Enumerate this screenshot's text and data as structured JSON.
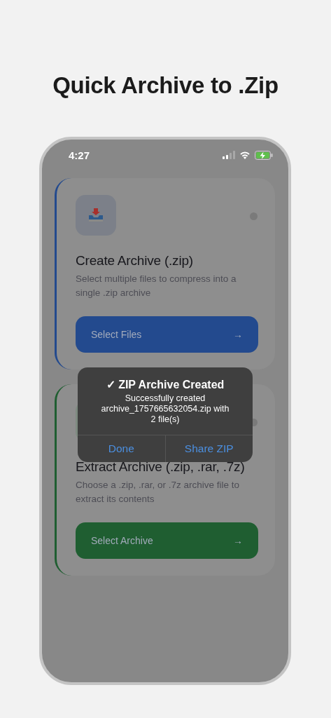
{
  "headline": "Quick Archive to .Zip",
  "status_bar": {
    "time": "4:27"
  },
  "cards": [
    {
      "title": "Create Archive (.zip)",
      "description": "Select multiple files to compress into a single .zip archive",
      "button": "Select Files",
      "arrow": "→",
      "color": "#234a8e"
    },
    {
      "title": "Extract Archive (.zip, .rar, .7z)",
      "description": "Choose a .zip, .rar, or .7z archive file to extract its contents",
      "button": "Select Archive",
      "arrow": "→",
      "color": "#1f5e31"
    }
  ],
  "alert": {
    "title": "✓ ZIP Archive Created",
    "message": "Successfully created archive_1757665632054.zip with 2 file(s)",
    "buttons": [
      "Done",
      "Share ZIP"
    ]
  }
}
